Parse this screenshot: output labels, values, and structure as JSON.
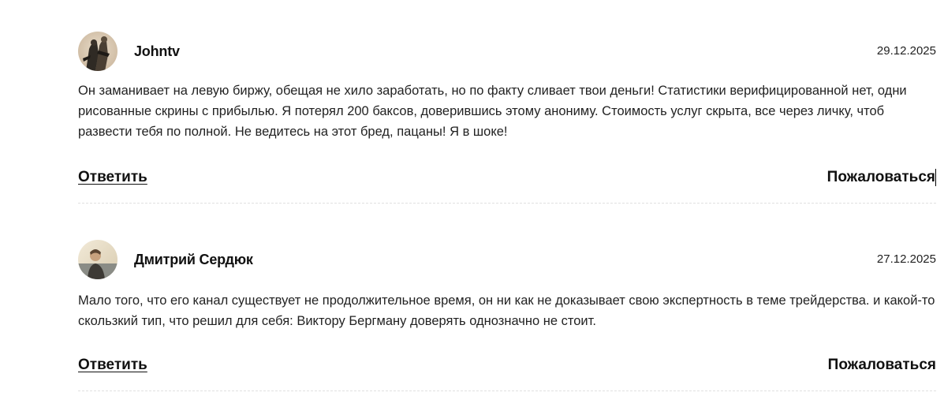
{
  "comments": [
    {
      "author": "Johntv",
      "date": "29.12.2025",
      "text": "Он заманивает на левую биржу, обещая не хило заработать, но по факту сливает твои деньги! Статистики верифицированной нет, одни рисованные скрины с прибылью. Я потерял 200 баксов, доверившись этому анониму. Стоимость услуг скрыта, все через личку, чтоб развести тебя по полной. Не ведитесь на этот бред, пацаны! Я в шоке!",
      "reply_label": "Ответить",
      "report_label": "Пожаловаться",
      "avatar_icon": "user-photo-icon"
    },
    {
      "author": "Дмитрий Сердюк",
      "date": "27.12.2025",
      "text": "Мало того, что его канал существует не продолжительное время, он ни как не доказывает свою экспертность в теме трейдерства. и какой-то скользкий тип, что решил для себя: Виктору Бергману доверять однозначно не стоит.",
      "reply_label": "Ответить",
      "report_label": "Пожаловаться",
      "avatar_icon": "user-photo-icon"
    }
  ],
  "colors": {
    "text": "#222222",
    "heading": "#111111",
    "separator": "#e0e0e0",
    "background": "#ffffff"
  }
}
